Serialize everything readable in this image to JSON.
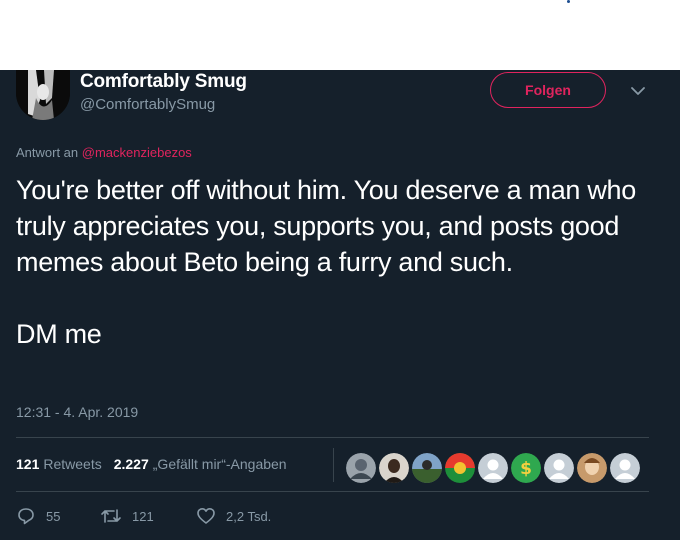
{
  "user": {
    "display_name": "Comfortably Smug",
    "handle": "@ComfortablySmug",
    "follow_label": "Folgen"
  },
  "reply": {
    "prefix": "Antwort an",
    "mention": "@mackenziebezos"
  },
  "tweet": {
    "paragraph_1": "You're better off without him. You deserve a man who truly appreciates you, supports you, and posts good memes about Beto being a furry and such.",
    "paragraph_2": "DM me",
    "timestamp": "12:31 - 4. Apr. 2019"
  },
  "stats": {
    "retweets_count": "121",
    "retweets_label": "Retweets",
    "likes_count": "2.227",
    "likes_label": "„Gefällt mir“-Angaben"
  },
  "likers": [
    "avatar-1",
    "avatar-2",
    "avatar-3",
    "avatar-4",
    "default-avatar",
    "dollar-avatar",
    "default-avatar",
    "avatar-8",
    "default-avatar"
  ],
  "actions": {
    "reply_count": "55",
    "retweet_count": "121",
    "like_count": "2,2 Tsd."
  },
  "colors": {
    "background": "#15202b",
    "text": "#ffffff",
    "secondary": "#8899a6",
    "accent": "#e0245e",
    "border": "#38444d"
  }
}
